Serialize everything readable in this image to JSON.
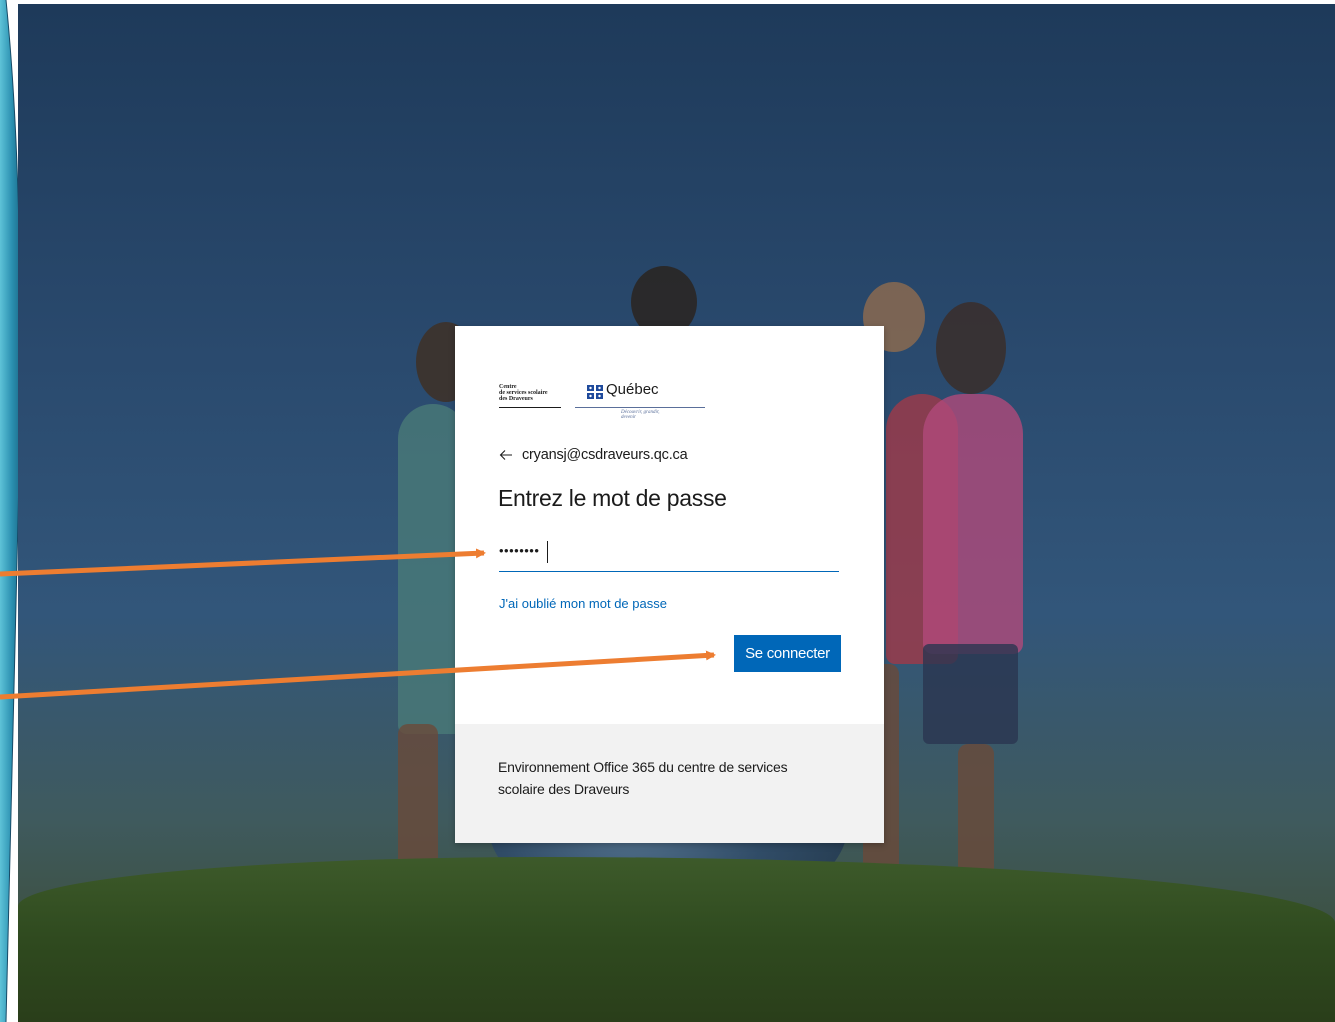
{
  "logo": {
    "org_name": "Centre de services scolaire des Draveurs",
    "org_line1": "Centre",
    "org_line2": "de services scolaire",
    "org_line3": "des Draveurs",
    "government_name": "Québec",
    "slogan": "Découvrir, grandir, devenir",
    "flag_color": "#1f4a9c"
  },
  "login": {
    "back_icon": "arrow-left-icon",
    "account_email": "cryansj@csdraveurs.qc.ca",
    "title": "Entrez le mot de passe",
    "password_masked": "••••••••",
    "forgot_link": "J'ai oublié mon mot de passe",
    "signin_label": "Se connecter"
  },
  "footer": {
    "text": "Environnement Office 365 du centre de services scolaire des Draveurs"
  },
  "colors": {
    "accent": "#0067b8",
    "annotation_arrow": "#ed7d31",
    "footer_bg": "#f2f2f2"
  }
}
